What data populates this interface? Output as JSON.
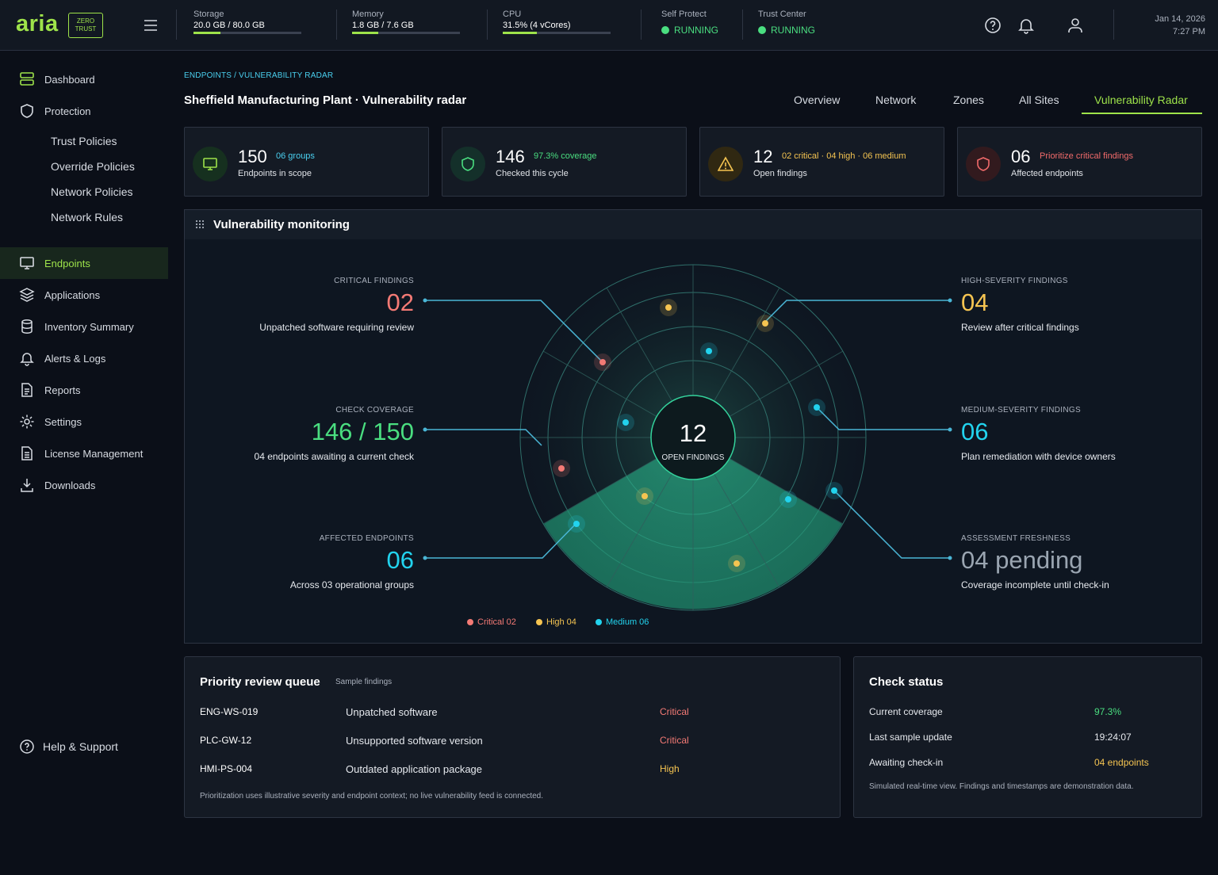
{
  "topbar": {
    "logo": "aria",
    "badge_line1": "ZERO",
    "badge_line2": "TRUST",
    "storage": {
      "label": "Storage",
      "value": "20.0 GB / 80.0 GB",
      "fill": 0.25
    },
    "memory": {
      "label": "Memory",
      "value": "1.8 GB / 7.6 GB",
      "fill": 0.24
    },
    "cpu": {
      "label": "CPU",
      "value": "31.5% (4 vCores)",
      "fill": 0.315
    },
    "self_protect": {
      "label": "Self Protect",
      "value": "RUNNING"
    },
    "trust_center": {
      "label": "Trust Center",
      "value": "RUNNING"
    },
    "date": "Jan 14, 2026",
    "time": "7:27 PM"
  },
  "sidebar": {
    "items": [
      {
        "label": "Dashboard",
        "icon": "dashboard-icon"
      },
      {
        "label": "Protection",
        "icon": "shield-icon"
      },
      {
        "label": "Endpoints",
        "icon": "monitor-icon"
      },
      {
        "label": "Applications",
        "icon": "layers-icon"
      },
      {
        "label": "Inventory Summary",
        "icon": "database-icon"
      },
      {
        "label": "Alerts & Logs",
        "icon": "bell-icon"
      },
      {
        "label": "Reports",
        "icon": "document-icon"
      },
      {
        "label": "Settings",
        "icon": "gear-icon"
      },
      {
        "label": "License Management",
        "icon": "license-icon"
      },
      {
        "label": "Downloads",
        "icon": "download-icon"
      }
    ],
    "subitems": [
      "Trust Policies",
      "Override Policies",
      "Network Policies",
      "Network Rules"
    ],
    "help": "Help & Support"
  },
  "page": {
    "breadcrumb": "ENDPOINTS / VULNERABILITY RADAR",
    "title": "Sheffield Manufacturing Plant · Vulnerability radar",
    "tabs": [
      "Overview",
      "Network",
      "Zones",
      "All Sites",
      "Vulnerability Radar"
    ]
  },
  "cards": [
    {
      "value": "150",
      "tag": "06 groups",
      "caption": "Endpoints in scope",
      "tag_color": "#4ad0f0"
    },
    {
      "value": "146",
      "tag": "97.3% coverage",
      "caption": "Checked this cycle",
      "tag_color": "#4ade80"
    },
    {
      "value": "12",
      "tag": "02 critical · 04 high · 06 medium",
      "caption": "Open findings",
      "tag_color": "#f5c451"
    },
    {
      "value": "06",
      "tag": "Prioritize critical findings",
      "caption": "Affected endpoints",
      "tag_color": "#f26b6b"
    }
  ],
  "monitor": {
    "title": "Vulnerability monitoring",
    "center_value": "12",
    "center_label": "OPEN FINDINGS",
    "left": [
      {
        "label": "CRITICAL FINDINGS",
        "value": "02",
        "caption": "Unpatched software requiring review",
        "color": "#f47a75"
      },
      {
        "label": "CHECK COVERAGE",
        "value": "146 / 150",
        "caption": "04 endpoints awaiting a current check",
        "color": "#4ade80"
      },
      {
        "label": "AFFECTED ENDPOINTS",
        "value": "06",
        "caption": "Across 03 operational groups",
        "color": "#22d3ee"
      }
    ],
    "right": [
      {
        "label": "HIGH-SEVERITY FINDINGS",
        "value": "04",
        "caption": "Review after critical findings",
        "color": "#f5c451"
      },
      {
        "label": "MEDIUM-SEVERITY FINDINGS",
        "value": "06",
        "caption": "Plan remediation with device owners",
        "color": "#22d3ee"
      },
      {
        "label": "ASSESSMENT FRESHNESS",
        "value": "04 pending",
        "caption": "Coverage incomplete until check-in",
        "color": "#9aa5b1"
      }
    ],
    "legend": [
      {
        "label": "Critical 02",
        "color": "#f47a75"
      },
      {
        "label": "High 04",
        "color": "#f5c451"
      },
      {
        "label": "Medium 06",
        "color": "#22d3ee"
      }
    ]
  },
  "queue": {
    "title": "Priority review queue",
    "subtitle": "Sample findings",
    "rows": [
      {
        "id": "ENG-WS-019",
        "desc": "Unpatched software",
        "sev": "Critical",
        "color": "#f47a75"
      },
      {
        "id": "PLC-GW-12",
        "desc": "Unsupported software version",
        "sev": "Critical",
        "color": "#f47a75"
      },
      {
        "id": "HMI-PS-004",
        "desc": "Outdated application package",
        "sev": "High",
        "color": "#f5c451"
      }
    ],
    "note": "Prioritization uses illustrative severity and endpoint context; no live vulnerability feed is connected."
  },
  "check_status": {
    "title": "Check status",
    "rows": [
      {
        "key": "Current coverage",
        "value": "97.3%",
        "color": "#4ade80"
      },
      {
        "key": "Last sample update",
        "value": "19:24:07",
        "color": "#e6e9ee"
      },
      {
        "key": "Awaiting check-in",
        "value": "04 endpoints",
        "color": "#f5c451"
      }
    ],
    "note": "Simulated real-time view. Findings and timestamps are demonstration data."
  }
}
